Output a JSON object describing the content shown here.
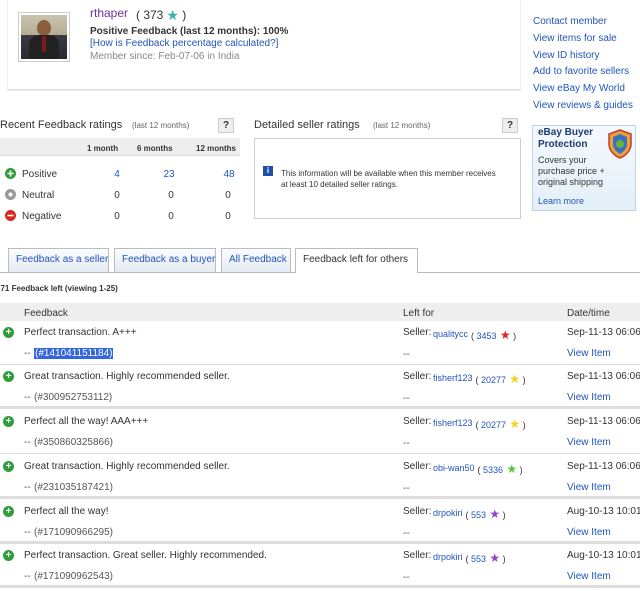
{
  "profile": {
    "username": "rthaper",
    "score_open": "( 373",
    "score_close": ")",
    "positive_feedback": "Positive Feedback (last 12 months): 100%",
    "how_calculated": "[How is Feedback percentage calculated?]",
    "member_since": "Member since: Feb-07-06 in India",
    "star_color": "#3db0a5"
  },
  "side_links": [
    "Contact member",
    "View items for sale",
    "View ID history",
    "Add to favorite sellers",
    "View eBay My World",
    "View reviews & guides"
  ],
  "recent_ratings": {
    "title": "Recent Feedback ratings",
    "subtitle": "(last 12 months)",
    "help": "?",
    "columns": [
      "1 month",
      "6 months",
      "12 months"
    ],
    "rows": [
      {
        "label": "Positive",
        "values": [
          "4",
          "23",
          "48"
        ],
        "icon": "positive-icon"
      },
      {
        "label": "Neutral",
        "values": [
          "0",
          "0",
          "0"
        ],
        "icon": "neutral-icon"
      },
      {
        "label": "Negative",
        "values": [
          "0",
          "0",
          "0"
        ],
        "icon": "negative-icon"
      }
    ]
  },
  "detailed_ratings": {
    "title": "Detailed seller ratings",
    "subtitle": "(last 12 months)",
    "help": "?",
    "message": "This information will be available when this member receives at least 10 detailed seller ratings.",
    "info_icon": "i"
  },
  "ad": {
    "title_line1": "eBay Buyer",
    "title_line2": "Protection",
    "text": "Covers your purchase price + original shipping",
    "learn_more": "Learn more"
  },
  "tabs": [
    "Feedback as a seller",
    "Feedback as a buyer",
    "All Feedback",
    "Feedback left for others"
  ],
  "active_tab": "Feedback left for others",
  "count_line": "371 Feedback left (viewing 1-25)",
  "table": {
    "headers": [
      "Feedback",
      "Left for",
      "Date/time"
    ],
    "rows": [
      {
        "text": "Perfect transaction. A+++",
        "item": "(#141041151184)",
        "item_prefix": "--",
        "seller_label": "Seller:",
        "seller": "qualitycc",
        "score": "3453",
        "star": "#d9271f",
        "date": "Sep-11-13 06:06",
        "view": "View Item",
        "dash": "--",
        "highlight": true
      },
      {
        "text": "Great transaction. Highly recommended seller.",
        "item": "(#300952753112)",
        "item_prefix": "--",
        "seller_label": "Seller:",
        "seller": "fisherf123",
        "score": "20277",
        "star": "#f2d21e",
        "date": "Sep-11-13 06:06",
        "view": "View Item",
        "dash": "--",
        "highlight": false
      },
      {
        "text": "Perfect all the way! AAA+++",
        "item": "(#350860325866)",
        "item_prefix": "--",
        "seller_label": "Seller:",
        "seller": "fisherf123",
        "score": "20277",
        "star": "#f2d21e",
        "date": "Sep-11-13 06:06",
        "view": "View Item",
        "dash": "--",
        "highlight": false
      },
      {
        "text": "Great transaction. Highly recommended seller.",
        "item": "(#231035187421)",
        "item_prefix": "--",
        "seller_label": "Seller:",
        "seller": "obi-wan50",
        "score": "5336",
        "star": "#5cc43a",
        "date": "Sep-11-13 06:06",
        "view": "View Item",
        "dash": "--",
        "highlight": false
      },
      {
        "text": "Perfect all the way!",
        "item": "(#171090966295)",
        "item_prefix": "--",
        "seller_label": "Seller:",
        "seller": "drpokiri",
        "score": "553",
        "star": "#8e44c4",
        "date": "Aug-10-13 10:01",
        "view": "View Item",
        "dash": "--",
        "highlight": false
      },
      {
        "text": "Perfect transaction. Great seller. Highly recommended.",
        "item": "(#171090962543)",
        "item_prefix": "--",
        "seller_label": "Seller:",
        "seller": "drpokiri",
        "score": "553",
        "star": "#8e44c4",
        "date": "Aug-10-13 10:01",
        "view": "View Item",
        "dash": "--",
        "highlight": false
      }
    ]
  }
}
